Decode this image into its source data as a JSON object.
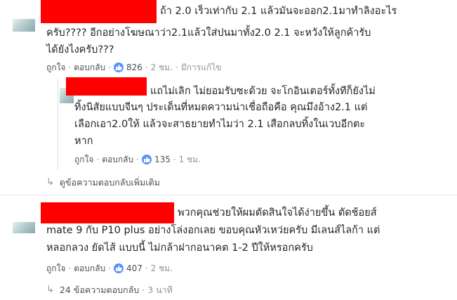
{
  "comment1": {
    "line1": "ถ้า 2.0 เร็วเท่ากับ 2.1 แล้วมันจะออก2.1มาทำลิงอะไร",
    "line2": "ครับ???? อีกอย่างโฆษณาว่า2.1แล้วใส่ปนมาทั้ง2.0 2.1 จะหวังให้ลูกค้ารับ",
    "line3": "ได้ยังไงครับ???",
    "like": "ถูกใจ",
    "reply": "ตอบกลับ",
    "reaction_count": "826",
    "time": "2 ชม.",
    "edited": "มีการแก้ไข"
  },
  "reply1": {
    "line1": "แถไม่เลิก ไม่ยอมรับซะด้วย จะโกอินเตอร์ทั้งทีก็ยังไม่",
    "line2": "ทิ้งนิสัยแบบจีนๆ ประเด็นที่หมดความน่าเชื่อถือคือ คุณมึงอ้าง2.1 แต่",
    "line3": "เลือกเอา2.0ให้ แล้วจะสาธยายทำไมว่า 2.1 เสือกลบทิ้งในเวบอีกตะ",
    "line4": "หาก",
    "like": "ถูกใจ",
    "reply": "ตอบกลับ",
    "reaction_count": "135",
    "time": "1 ชม."
  },
  "more_replies": "ดูข้อความตอบกลับเพิ่มเติม",
  "comment2": {
    "line1": "พวกคุณช่วยให้ผมตัดสินใจได้ง่ายขึ้น ตัดช้อยส์",
    "line2": "mate 9 กับ P10 plus อย่างโล่งอกเลย ขอบคุณหัวเหว่ยครับ มีเลนส์ไลก้า แต่",
    "line3": "หลอกลวง ยัดไส้ แบบนี้ ไม่กล้าฝากอนาคต 1-2 ปีให้หรอกครับ",
    "like": "ถูกใจ",
    "reply": "ตอบกลับ",
    "reaction_count": "407",
    "time": "2 ชม."
  },
  "replies_link": {
    "label": "24 ข้อความตอบกลับ",
    "time": "3 นาที"
  },
  "colors": {
    "redaction": "#ff0000",
    "like_blue": "#5890ff",
    "meta_gray": "#90949c"
  }
}
